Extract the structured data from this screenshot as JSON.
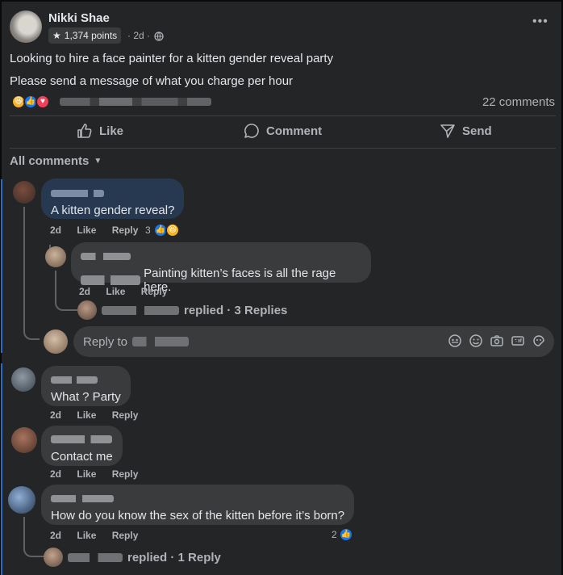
{
  "post": {
    "author": "Nikki Shae",
    "points": "1,374 points",
    "time": "· 2d ·",
    "line1": "Looking to hire a face painter for a kitten gender reveal party",
    "line2": "Please send a message of what you charge per hour",
    "comments_count": "22 comments"
  },
  "actions": {
    "like": "Like",
    "comment": "Comment",
    "send": "Send"
  },
  "filter": {
    "label": "All comments"
  },
  "comments": [
    {
      "text": "A kitten gender reveal?",
      "time": "2d",
      "like": "Like",
      "reply": "Reply",
      "reactions_count": "3"
    },
    {
      "text": "Painting kitten’s faces is all the rage here.",
      "time": "2d",
      "like": "Like",
      "reply": "Reply",
      "replies_summary": "replied · 3 Replies"
    },
    {
      "text": "What ? Party",
      "time": "2d",
      "like": "Like",
      "reply": "Reply"
    },
    {
      "text": "Contact me",
      "time": "2d",
      "like": "Like",
      "reply": "Reply"
    },
    {
      "text": "How do you know the sex of the kitten before it’s born?",
      "time": "2d",
      "like": "Like",
      "reply": "Reply",
      "reactions_count": "2",
      "replies_summary": "replied · 1 Reply"
    }
  ],
  "reply_box": {
    "placeholder": "Reply to"
  },
  "icons": {
    "star": "star-icon",
    "globe": "globe-icon",
    "more": "more-icon",
    "like": "thumbs-up-icon",
    "comment": "comment-bubble-icon",
    "send": "send-icon",
    "chevron": "chevron-down-icon"
  },
  "colors": {
    "background": "#242526",
    "bubble": "#3a3b3c",
    "highlight_bubble": "#263951",
    "like_blue": "#1877f2"
  }
}
